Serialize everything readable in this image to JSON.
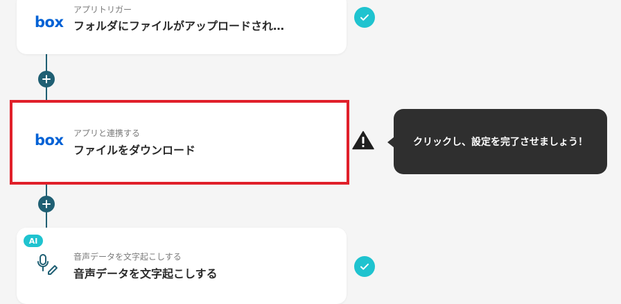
{
  "steps": [
    {
      "app_logo": "box",
      "subtitle": "アプリトリガー",
      "title": "フォルダにファイルがアップロードされ…",
      "status": "completed",
      "icon": "box-logo"
    },
    {
      "app_logo": "box",
      "subtitle": "アプリと連携する",
      "title": "ファイルをダウンロード",
      "status": "warning",
      "icon": "box-logo"
    },
    {
      "badge": "AI",
      "subtitle": "音声データを文字起こしする",
      "title": "音声データを文字起こしする",
      "status": "completed",
      "icon": "microphone-pen-icon"
    }
  ],
  "tooltip": {
    "text": "クリックし、設定を完了させましょう！"
  },
  "colors": {
    "accent_teal": "#1fc3cf",
    "connector": "#1f5f73",
    "selection_border": "#e0202a",
    "box_blue": "#0061d5",
    "tooltip_bg": "#2f2f2f"
  }
}
